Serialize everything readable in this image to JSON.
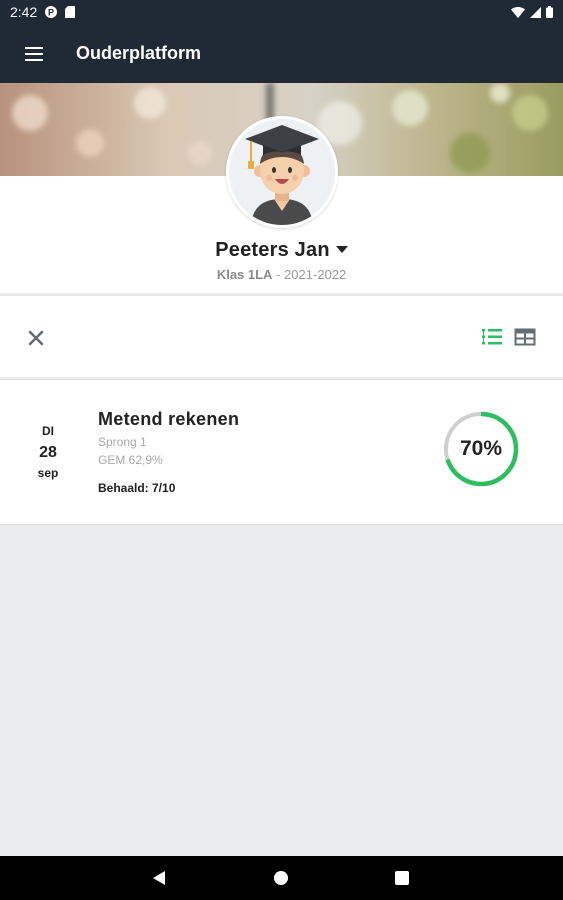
{
  "status_bar": {
    "time": "2:42"
  },
  "app_bar": {
    "title": "Ouderplatform"
  },
  "profile": {
    "name": "Peeters Jan",
    "klas": "Klas 1LA",
    "separator": " - ",
    "school_year": "2021-2022"
  },
  "result": {
    "date": {
      "day": "DI",
      "number": "28",
      "month": "sep"
    },
    "title": "Metend rekenen",
    "subtitle": "Sprong 1",
    "average": "GEM 62,9%",
    "achieved": "Behaald: 7/10",
    "score_percent": 70,
    "score_label": "70%"
  },
  "colors": {
    "app_bar": "#1f2a36",
    "accent_green": "#2dbe5f",
    "ring_track": "#cfcfcf",
    "page_bg": "#eaeced"
  },
  "icons": {
    "menu": "hamburger-icon",
    "close": "close-icon",
    "list_view": "list-view-icon",
    "grid_view": "table-view-icon"
  }
}
